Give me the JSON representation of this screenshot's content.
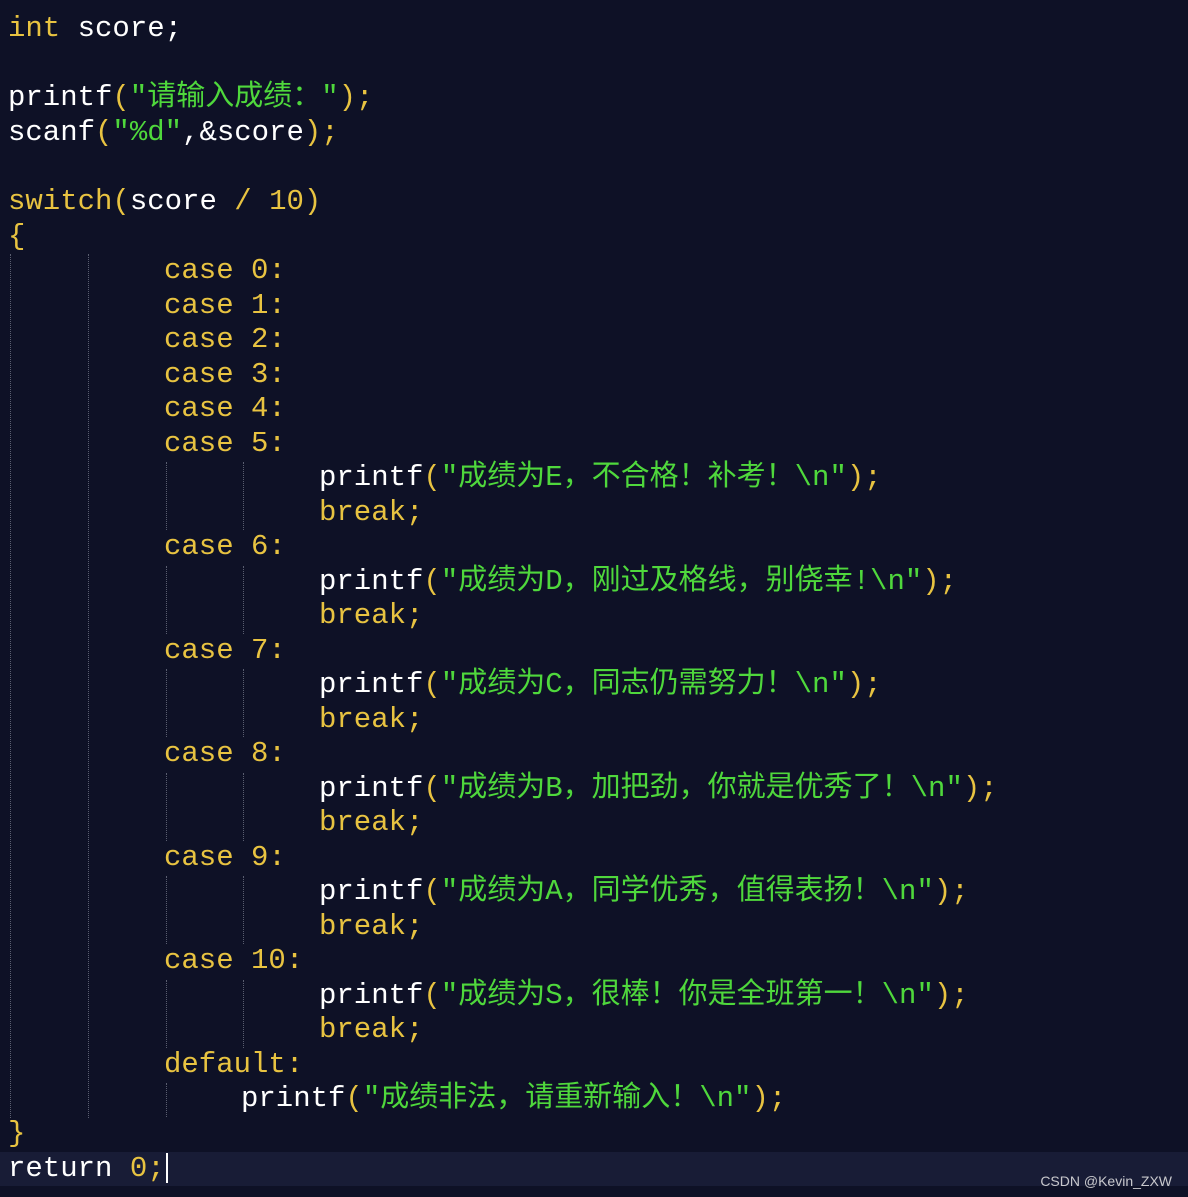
{
  "theme": {
    "background": "#0e1126",
    "current_line": "#181c36",
    "keyword": "#e8c341",
    "function": "#ffffff",
    "string": "#4fd83c",
    "number": "#e8c341",
    "identifier": "#ffffff"
  },
  "code": {
    "l1": {
      "kw": "int",
      "rest": " score;"
    },
    "l3": {
      "fn": "printf",
      "open": "(",
      "str": "\"请输入成绩：\"",
      "close": ");"
    },
    "l4": {
      "fn": "scanf",
      "open": "(",
      "str": "\"%d\"",
      "mid": ",&score",
      "close": ");"
    },
    "l6": {
      "kw": "switch",
      "open": "(",
      "id": "score",
      "op": " / ",
      "num": "10",
      "close": ")"
    },
    "l7": {
      "text": "{"
    },
    "cases": [
      {
        "kw": "case",
        "label": " 0:"
      },
      {
        "kw": "case",
        "label": " 1:"
      },
      {
        "kw": "case",
        "label": " 2:"
      },
      {
        "kw": "case",
        "label": " 3:"
      },
      {
        "kw": "case",
        "label": " 4:"
      },
      {
        "kw": "case",
        "label": " 5:"
      }
    ],
    "blocks": [
      {
        "printf": "printf",
        "str": "\"成绩为E，不合格！补考！\\n\"",
        "close": ");",
        "brk": "break;",
        "next_case": "case",
        "next_label": " 6:"
      },
      {
        "printf": "printf",
        "str": "\"成绩为D，刚过及格线，别侥幸!\\n\"",
        "close": ");",
        "brk": "break;",
        "next_case": "case",
        "next_label": " 7:"
      },
      {
        "printf": "printf",
        "str": "\"成绩为C，同志仍需努力！\\n\"",
        "close": ");",
        "brk": "break;",
        "next_case": "case",
        "next_label": " 8:"
      },
      {
        "printf": "printf",
        "str": "\"成绩为B，加把劲，你就是优秀了！\\n\"",
        "close": ");",
        "brk": "break;",
        "next_case": "case",
        "next_label": " 9:"
      },
      {
        "printf": "printf",
        "str": "\"成绩为A，同学优秀，值得表扬！\\n\"",
        "close": ");",
        "brk": "break;",
        "next_case": "case",
        "next_label": " 10:"
      },
      {
        "printf": "printf",
        "str": "\"成绩为S，很棒！你是全班第一！\\n\"",
        "close": ");",
        "brk": "break;"
      }
    ],
    "default": {
      "kw": "default:",
      "printf": "printf",
      "str": "\"成绩非法，请重新输入！\\n\"",
      "close": ");"
    },
    "close_brace": "}",
    "ret": {
      "kw": "return",
      "num": " 0",
      "semi": ";"
    }
  },
  "watermark": "CSDN @Kevin_ZXW"
}
